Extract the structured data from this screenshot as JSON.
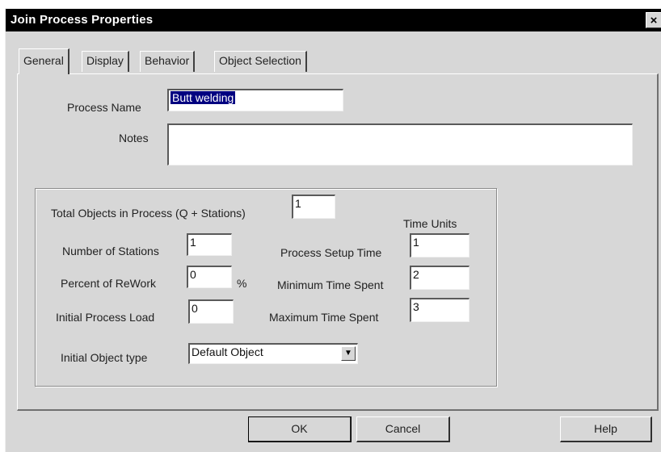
{
  "window": {
    "title": "Join Process Properties",
    "close_label": "×"
  },
  "tabs": [
    {
      "label": "General",
      "active": true
    },
    {
      "label": "Display",
      "active": false
    },
    {
      "label": "Behavior",
      "active": false
    },
    {
      "label": "Object Selection",
      "active": false
    }
  ],
  "general": {
    "process_name_label": "Process Name",
    "process_name_value": "Butt welding",
    "notes_label": "Notes",
    "notes_value": "",
    "total_objects_label": "Total Objects in Process (Q + Stations)",
    "total_objects_value": "1",
    "time_units_label": "Time Units",
    "stations_label": "Number of Stations",
    "stations_value": "1",
    "rework_label": "Percent of ReWork",
    "rework_value": "0",
    "rework_unit": "%",
    "initial_load_label": "Initial Process Load",
    "initial_load_value": "0",
    "setup_time_label": "Process Setup Time",
    "setup_time_value": "1",
    "min_time_label": "Minimum Time Spent",
    "min_time_value": "2",
    "max_time_label": "Maximum Time Spent",
    "max_time_value": "3",
    "object_type_label": "Initial Object type",
    "object_type_value": "Default Object",
    "dropdown_arrow": "▼"
  },
  "buttons": {
    "ok": "OK",
    "cancel": "Cancel",
    "help": "Help"
  }
}
